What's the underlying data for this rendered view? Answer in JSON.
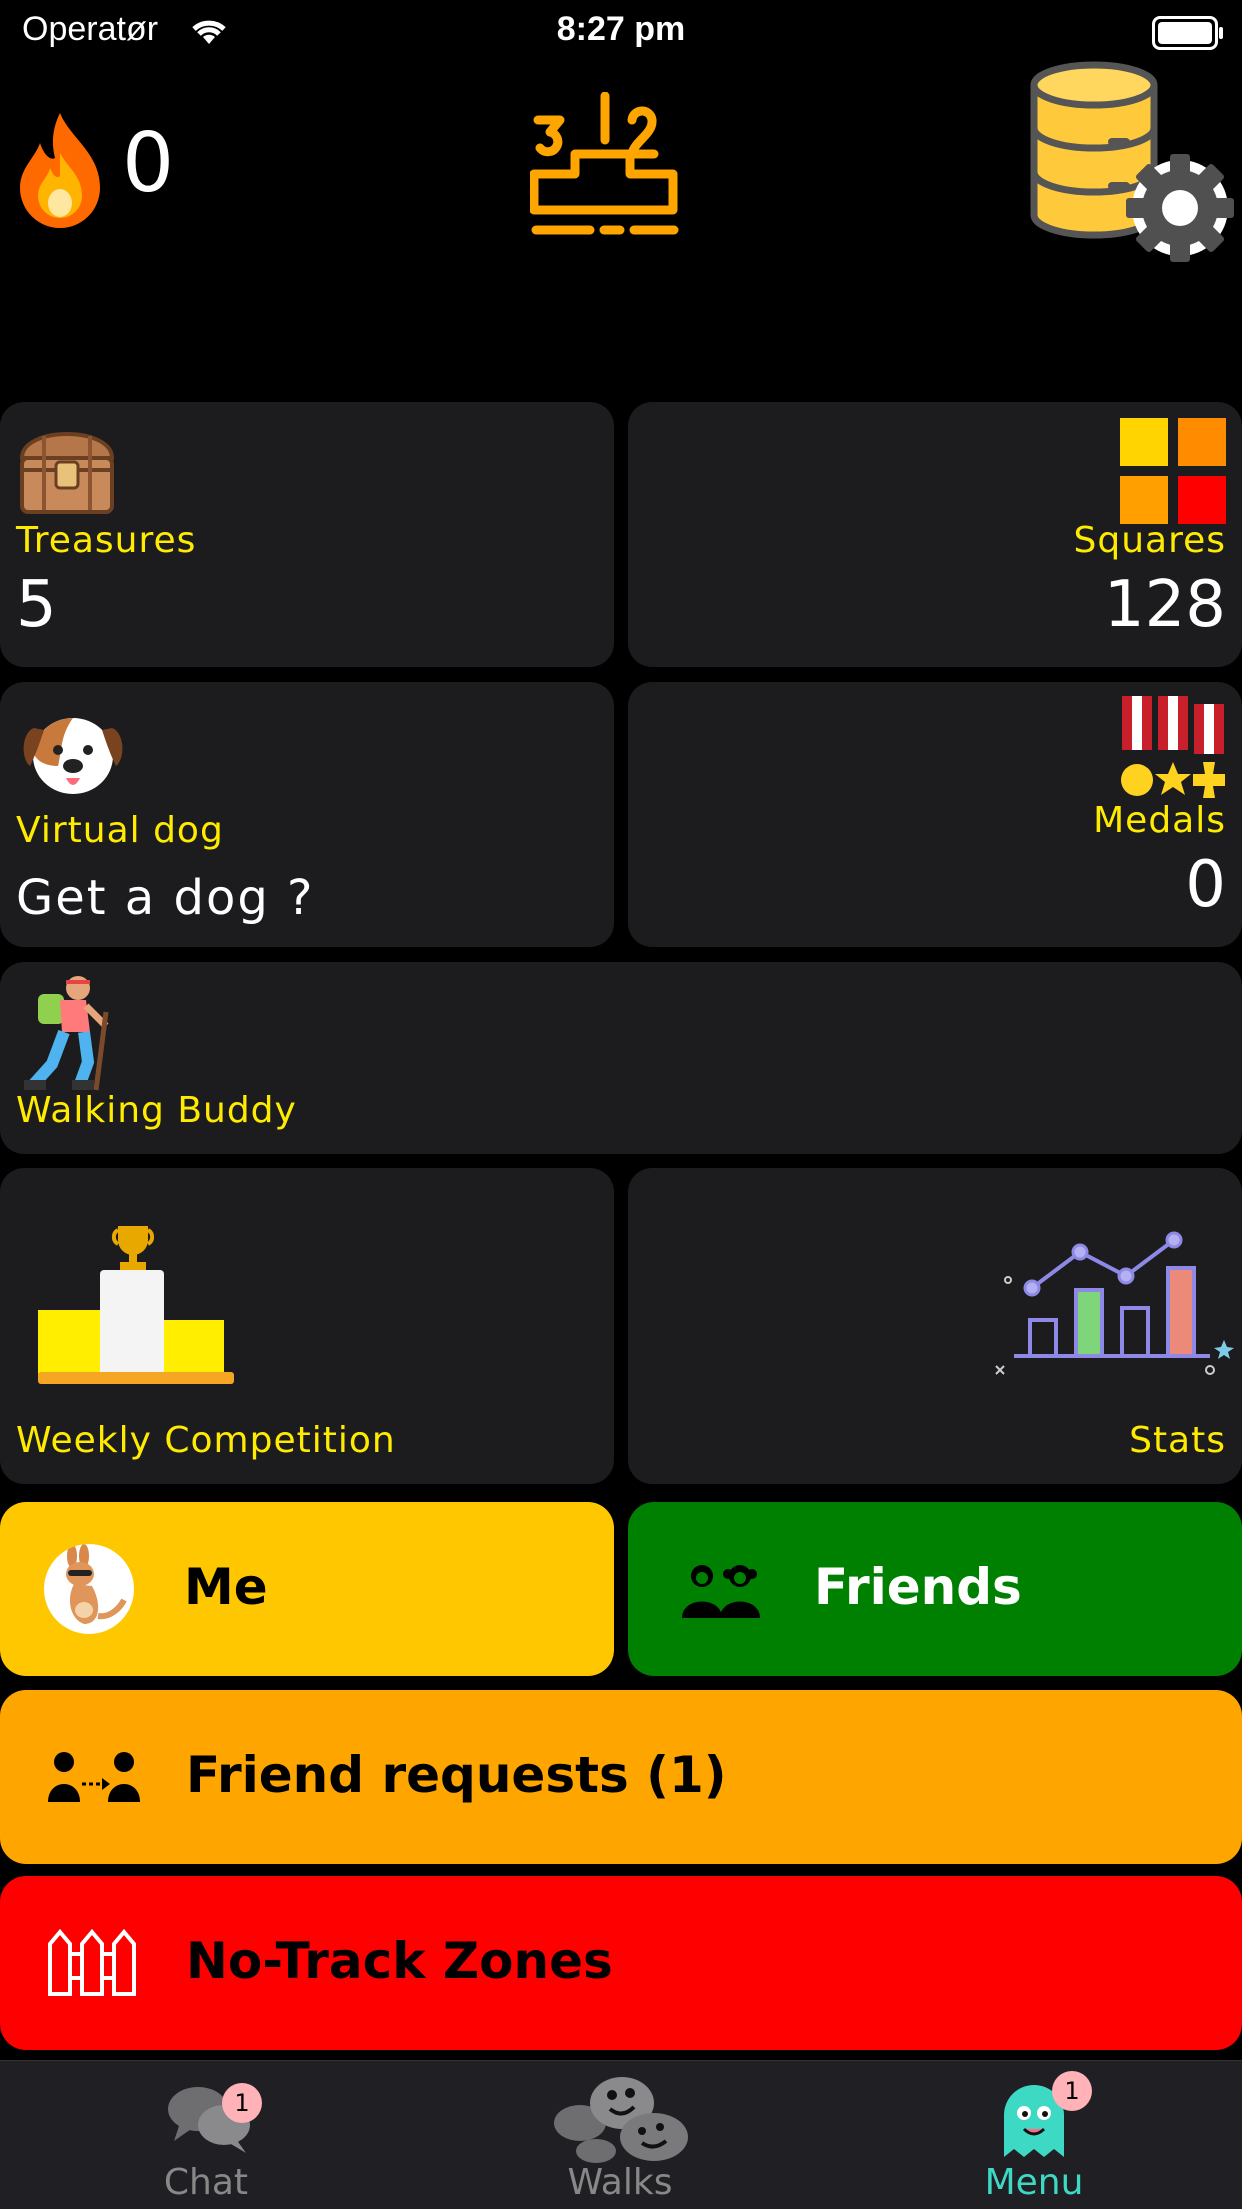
{
  "status_bar": {
    "carrier": "Operatør",
    "time": "8:27 pm"
  },
  "header": {
    "streak_count": "0"
  },
  "cards": {
    "treasures": {
      "label": "Treasures",
      "value": "5"
    },
    "squares": {
      "label": "Squares",
      "value": "128"
    },
    "virtual_dog": {
      "label": "Virtual dog",
      "value": "Get a dog ?"
    },
    "medals": {
      "label": "Medals",
      "value": "0"
    },
    "walking_buddy": {
      "label": "Walking Buddy"
    },
    "weekly_competition": {
      "label": "Weekly Competition"
    },
    "stats": {
      "label": "Stats"
    }
  },
  "buttons": {
    "me": "Me",
    "friends": "Friends",
    "friend_requests": "Friend requests (1)",
    "no_track_zones": "No-Track Zones"
  },
  "tabs": [
    {
      "label": "Chat",
      "badge": "1"
    },
    {
      "label": "Walks"
    },
    {
      "label": "Menu",
      "badge": "1"
    }
  ],
  "colors": {
    "accent_yellow": "#ffeb00",
    "me_button": "#ffc700",
    "friends_button": "#008000",
    "friend_requests_button": "#ffa500",
    "no_track_button": "#ff0000",
    "active_tab": "#3dd9c5"
  }
}
